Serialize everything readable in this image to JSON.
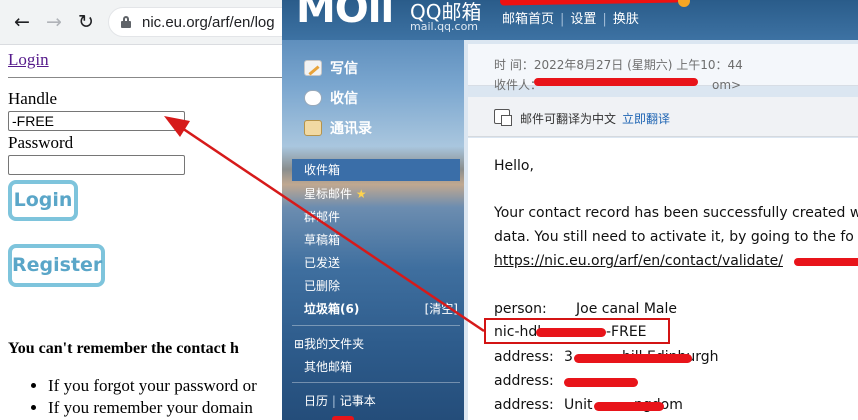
{
  "browser": {
    "url": "nic.eu.org/arf/en/log",
    "login_link": "Login",
    "handle_label": "Handle",
    "handle_value": "-FREE",
    "password_label": "Password",
    "password_value": "",
    "login_button": "Login",
    "register_button": "Register",
    "forgot_heading": "You can't remember the contact h",
    "bullets": [
      "If you forgot your password or",
      "If you remember your domain"
    ]
  },
  "qqmail": {
    "brand": "QQ邮箱",
    "domain": "mail.qq.com",
    "top_links": [
      "邮箱首页",
      "设置",
      "换肤"
    ],
    "nav": {
      "write": "写信",
      "inbox": "收信",
      "contacts": "通讯录"
    },
    "folders": {
      "inbox": "收件箱",
      "starred": "星标邮件",
      "group": "群邮件",
      "drafts": "草稿箱",
      "sent": "已发送",
      "deleted": "已删除",
      "spam": "垃圾箱(6)",
      "spam_clear": "[清空]",
      "my_folders": "我的文件夹",
      "other": "其他邮箱",
      "calendar": "日历",
      "notes": "记事本"
    },
    "mail": {
      "time_line": "时  间：2022年8月27日 (星期六) 上午10：44",
      "to_label": "收件人：",
      "to_tail": "om>",
      "translate_text": "邮件可翻译为中文",
      "translate_link": "立即翻译",
      "greeting": "Hello,",
      "body_line1": "Your contact record has been successfully created w",
      "body_line2": "data. You still need to activate it, by going to the fo",
      "validate_link": "https://nic.eu.org/arf/en/contact/validate/",
      "person_label": "person:",
      "person_value": "Joe canal Male",
      "nichdl_label": "nic-hdl:",
      "nichdl_value": "-FREE",
      "address_label": "address:",
      "address1_value": "3",
      "address1_tail": "hill Edinburgh",
      "address2_tail": "",
      "address3_value": "Unit",
      "address3_tail": "ngdom"
    }
  }
}
